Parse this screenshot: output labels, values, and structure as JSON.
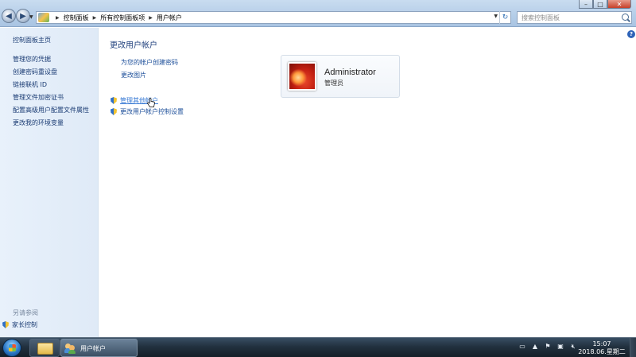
{
  "window": {
    "min_glyph": "–",
    "max_glyph": "□",
    "close_glyph": "✕"
  },
  "address": {
    "crumbs": [
      "控制面板",
      "所有控制面板项",
      "用户帐户"
    ]
  },
  "search": {
    "placeholder": "搜索控制面板"
  },
  "sidebar": {
    "home": "控制面板主页",
    "links": [
      "管理您的凭据",
      "创建密码重设盘",
      "链接联机 ID",
      "管理文件加密证书",
      "配置高级用户配置文件属性",
      "更改我的环境变量"
    ],
    "see_also": "另请参阅",
    "parental": "家长控制"
  },
  "main": {
    "title": "更改用户帐户",
    "links": {
      "create_password": "为您的帐户创建密码",
      "change_picture": "更改图片",
      "manage_other": "管理其他帐户",
      "uac_settings": "更改用户帐户控制设置"
    },
    "help": "?"
  },
  "account": {
    "name": "Administrator",
    "role": "管理员"
  },
  "taskbar": {
    "active_window": "用户帐户",
    "time": "15:07",
    "date": "2018.06.星期二"
  },
  "colors": {
    "link": "#1d4f9a",
    "title": "#1e3f7c",
    "sidebar_bg": "#e8f1fb",
    "taskbar": "#22313f"
  },
  "icons": [
    "back-icon",
    "forward-icon",
    "control-panel-icon",
    "refresh-icon",
    "search-icon",
    "help-icon",
    "shield-icon",
    "start-orb-icon",
    "folder-icon",
    "users-icon",
    "keyboard-icon",
    "flag-icon",
    "network-icon",
    "volume-muted-icon"
  ]
}
